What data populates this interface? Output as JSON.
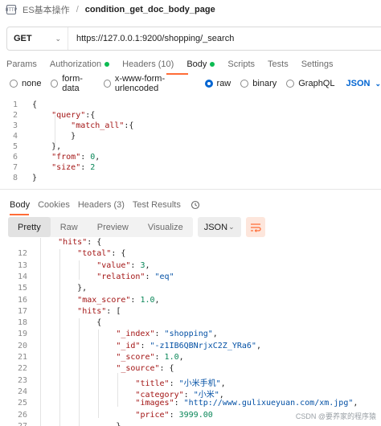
{
  "breadcrumb": {
    "app_icon_text": "HTTP",
    "parent": "ES基本操作",
    "separator": "/",
    "current": "condition_get_doc_body_page"
  },
  "request": {
    "method": "GET",
    "url": "https://127.0.0.1:9200/shopping/_search"
  },
  "request_tabs": [
    {
      "label": "Params",
      "active": false,
      "dot": false
    },
    {
      "label": "Authorization",
      "active": false,
      "dot": true
    },
    {
      "label": "Headers (10)",
      "active": false,
      "dot": false
    },
    {
      "label": "Body",
      "active": true,
      "dot": true
    },
    {
      "label": "Scripts",
      "active": false,
      "dot": false
    },
    {
      "label": "Tests",
      "active": false,
      "dot": false
    },
    {
      "label": "Settings",
      "active": false,
      "dot": false
    }
  ],
  "body_types": [
    {
      "label": "none",
      "checked": false
    },
    {
      "label": "form-data",
      "checked": false
    },
    {
      "label": "x-www-form-urlencoded",
      "checked": false
    },
    {
      "label": "raw",
      "checked": true
    },
    {
      "label": "binary",
      "checked": false
    },
    {
      "label": "GraphQL",
      "checked": false
    }
  ],
  "raw_language": "JSON",
  "request_body": [
    {
      "num": "1",
      "segs": [
        [
          "p",
          "{"
        ]
      ]
    },
    {
      "num": "2",
      "segs": [
        [
          "p",
          "    "
        ],
        [
          "k",
          "\"query\""
        ],
        [
          "p",
          ":{"
        ]
      ]
    },
    {
      "num": "3",
      "segs": [
        [
          "p",
          "        "
        ],
        [
          "k",
          "\"match_all\""
        ],
        [
          "p",
          ":{"
        ]
      ]
    },
    {
      "num": "4",
      "segs": [
        [
          "p",
          "        }"
        ]
      ]
    },
    {
      "num": "5",
      "segs": [
        [
          "p",
          "    },"
        ]
      ]
    },
    {
      "num": "6",
      "segs": [
        [
          "p",
          "    "
        ],
        [
          "k",
          "\"from\""
        ],
        [
          "p",
          ": "
        ],
        [
          "n",
          "0"
        ],
        [
          "p",
          ","
        ]
      ]
    },
    {
      "num": "7",
      "segs": [
        [
          "p",
          "    "
        ],
        [
          "k",
          "\"size\""
        ],
        [
          "p",
          ": "
        ],
        [
          "n",
          "2"
        ]
      ]
    },
    {
      "num": "8",
      "segs": [
        [
          "p",
          "}"
        ]
      ]
    }
  ],
  "response_tabs": [
    {
      "label": "Body",
      "active": true
    },
    {
      "label": "Cookies",
      "active": false
    },
    {
      "label": "Headers (3)",
      "active": false
    },
    {
      "label": "Test Results",
      "active": false
    }
  ],
  "view_modes": [
    {
      "label": "Pretty",
      "active": true
    },
    {
      "label": "Raw",
      "active": false
    },
    {
      "label": "Preview",
      "active": false
    },
    {
      "label": "Visualize",
      "active": false
    }
  ],
  "response_format": "JSON",
  "response_body": [
    {
      "num": "",
      "segs": [
        [
          "p",
          "    "
        ],
        [
          "k",
          "\"hits\""
        ],
        [
          "p",
          ": {"
        ]
      ]
    },
    {
      "num": "12",
      "segs": [
        [
          "p",
          "        "
        ],
        [
          "k",
          "\"total\""
        ],
        [
          "p",
          ": {"
        ]
      ]
    },
    {
      "num": "13",
      "segs": [
        [
          "p",
          "            "
        ],
        [
          "k",
          "\"value\""
        ],
        [
          "p",
          ": "
        ],
        [
          "n",
          "3"
        ],
        [
          "p",
          ","
        ]
      ]
    },
    {
      "num": "14",
      "segs": [
        [
          "p",
          "            "
        ],
        [
          "k",
          "\"relation\""
        ],
        [
          "p",
          ": "
        ],
        [
          "s",
          "\"eq\""
        ]
      ]
    },
    {
      "num": "15",
      "segs": [
        [
          "p",
          "        },"
        ]
      ]
    },
    {
      "num": "16",
      "segs": [
        [
          "p",
          "        "
        ],
        [
          "k",
          "\"max_score\""
        ],
        [
          "p",
          ": "
        ],
        [
          "n",
          "1.0"
        ],
        [
          "p",
          ","
        ]
      ]
    },
    {
      "num": "17",
      "segs": [
        [
          "p",
          "        "
        ],
        [
          "k",
          "\"hits\""
        ],
        [
          "p",
          ": ["
        ]
      ]
    },
    {
      "num": "18",
      "segs": [
        [
          "p",
          "            {"
        ]
      ]
    },
    {
      "num": "19",
      "segs": [
        [
          "p",
          "                "
        ],
        [
          "k",
          "\"_index\""
        ],
        [
          "p",
          ": "
        ],
        [
          "s",
          "\"shopping\""
        ],
        [
          "p",
          ","
        ]
      ]
    },
    {
      "num": "20",
      "segs": [
        [
          "p",
          "                "
        ],
        [
          "k",
          "\"_id\""
        ],
        [
          "p",
          ": "
        ],
        [
          "s",
          "\"-z1IB6QBNrjxC2Z_YRa6\""
        ],
        [
          "p",
          ","
        ]
      ]
    },
    {
      "num": "21",
      "segs": [
        [
          "p",
          "                "
        ],
        [
          "k",
          "\"_score\""
        ],
        [
          "p",
          ": "
        ],
        [
          "n",
          "1.0"
        ],
        [
          "p",
          ","
        ]
      ]
    },
    {
      "num": "22",
      "segs": [
        [
          "p",
          "                "
        ],
        [
          "k",
          "\"_source\""
        ],
        [
          "p",
          ": {"
        ]
      ]
    },
    {
      "num": "23",
      "segs": [
        [
          "p",
          "                    "
        ],
        [
          "k",
          "\"title\""
        ],
        [
          "p",
          ": "
        ],
        [
          "s",
          "\"小米手机\""
        ],
        [
          "p",
          ","
        ]
      ]
    },
    {
      "num": "24",
      "segs": [
        [
          "p",
          "                    "
        ],
        [
          "k",
          "\"category\""
        ],
        [
          "p",
          ": "
        ],
        [
          "s",
          "\"小米\""
        ],
        [
          "p",
          ","
        ]
      ]
    },
    {
      "num": "25",
      "segs": [
        [
          "p",
          "                    "
        ],
        [
          "k",
          "\"images\""
        ],
        [
          "p",
          ": "
        ],
        [
          "s",
          "\"http://www.gulixueyuan.com/xm.jpg\""
        ],
        [
          "p",
          ","
        ]
      ]
    },
    {
      "num": "26",
      "segs": [
        [
          "p",
          "                    "
        ],
        [
          "k",
          "\"price\""
        ],
        [
          "p",
          ": "
        ],
        [
          "n",
          "3999.00"
        ]
      ]
    },
    {
      "num": "27",
      "segs": [
        [
          "p",
          "                }"
        ]
      ]
    },
    {
      "num": "",
      "segs": [
        [
          "p",
          "            },"
        ]
      ]
    }
  ],
  "watermark": "CSDN @要养家的程序猿",
  "colors": {
    "accent": "#ff6c37",
    "active_dot": "#0cbb52",
    "radio_checked": "#0265d2",
    "json_key": "#a31515",
    "json_string": "#0451a5",
    "json_number": "#098658"
  }
}
